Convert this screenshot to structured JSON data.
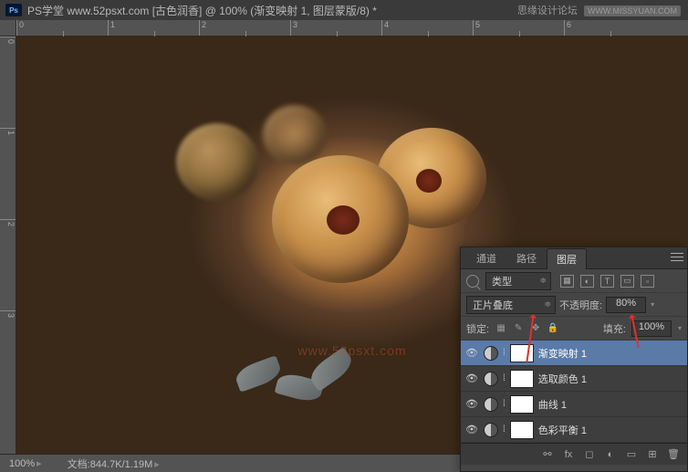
{
  "title": {
    "ps_logo": "Ps",
    "text": "PS学堂  www.52psxt.com [古色润香] @ 100% (渐变映射 1, 图层蒙版/8) *"
  },
  "watermark": {
    "text1": "思缘设计论坛",
    "text2": "WWW.MISSYUAN.COM",
    "canvas": "www.52psxt.com"
  },
  "ruler_h": [
    "0",
    "1",
    "2",
    "3",
    "4",
    "5",
    "6"
  ],
  "ruler_v": [
    "0",
    "1",
    "2",
    "3"
  ],
  "status": {
    "zoom": "100%",
    "doc_label": "文档:",
    "doc_value": "844.7K/1.19M"
  },
  "panel": {
    "tabs": {
      "channels": "通道",
      "paths": "路径",
      "layers": "图层"
    },
    "kind": "类型",
    "filter_T": "T",
    "blend_mode": "正片叠底",
    "opacity_label": "不透明度:",
    "opacity_value": "80%",
    "lock_label": "锁定:",
    "fill_label": "填充:",
    "fill_value": "100%",
    "layers": [
      {
        "name": "渐变映射 1",
        "selected": true
      },
      {
        "name": "选取颜色 1",
        "selected": false
      },
      {
        "name": "曲线 1",
        "selected": false
      },
      {
        "name": "色彩平衡 1",
        "selected": false
      }
    ],
    "footer_fx": "fx"
  }
}
